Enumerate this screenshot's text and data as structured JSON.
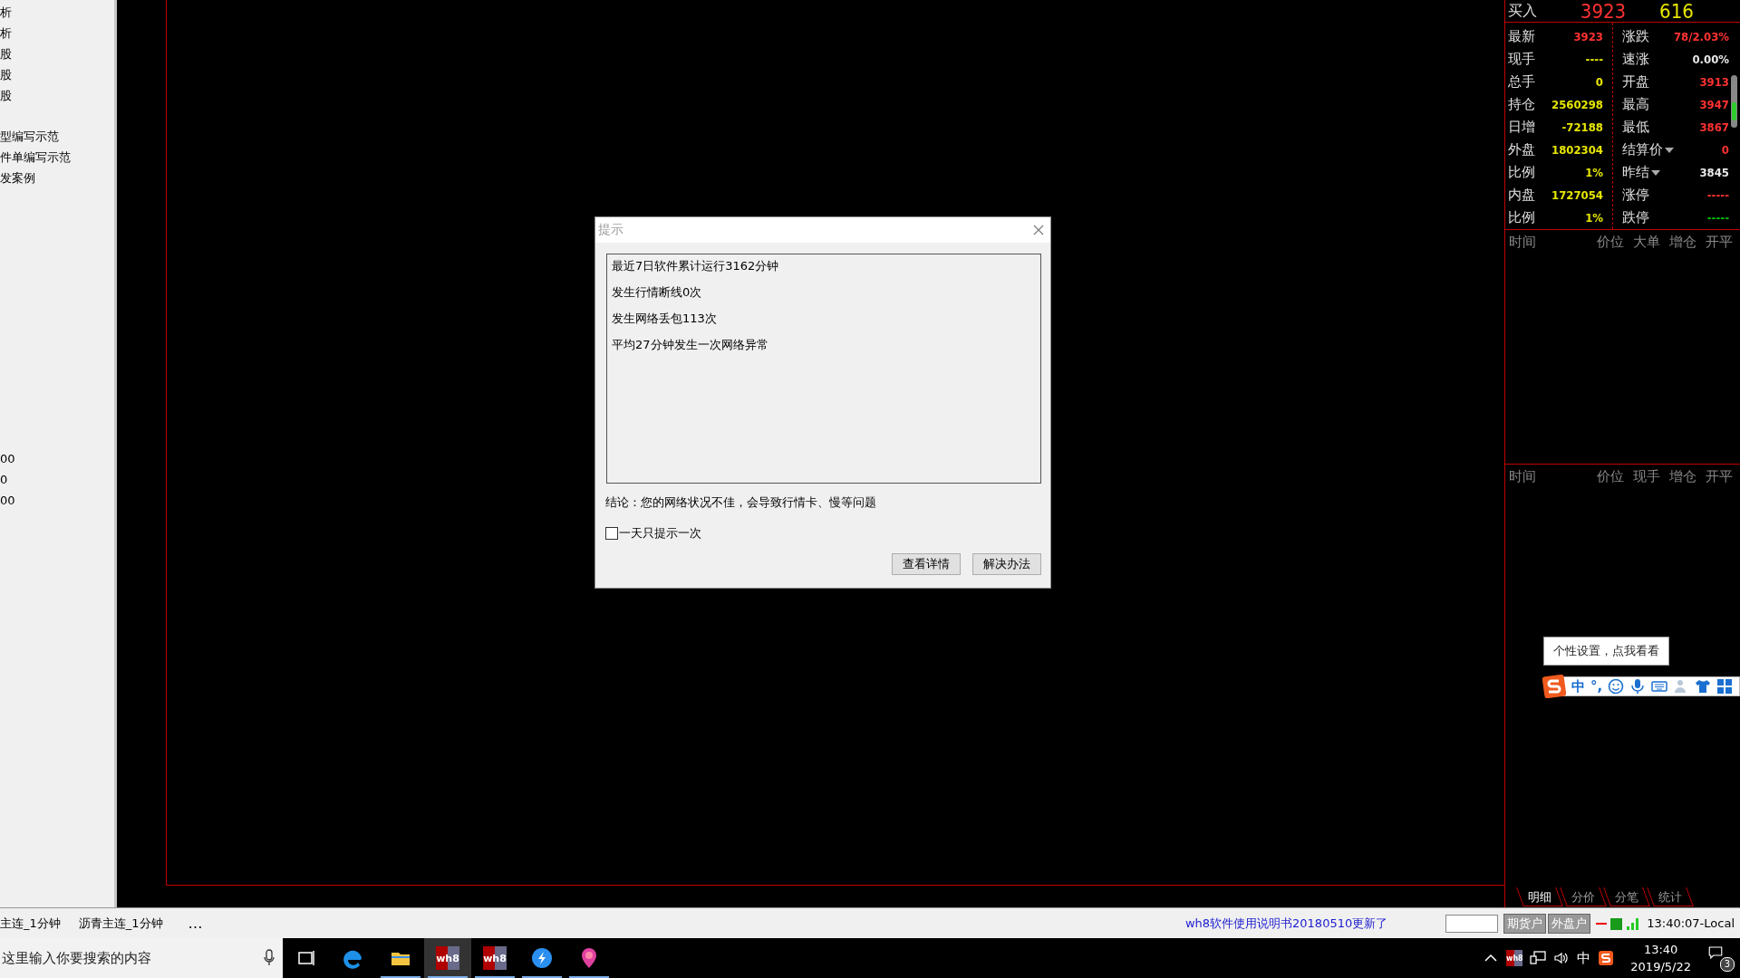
{
  "sidebar": {
    "groups": [
      [
        "析",
        "析",
        "股",
        "股",
        "股"
      ],
      [
        "型编写示范",
        "件单编写示范",
        "发案例"
      ],
      [
        "00",
        "0",
        "00"
      ]
    ]
  },
  "quote": {
    "buy_label": "买入",
    "buy_price": "3923",
    "buy_volume": "616",
    "left_rows": [
      {
        "label": "最新",
        "value": "3923",
        "color": "#ff3232"
      },
      {
        "label": "现手",
        "value": "----",
        "color": "#e6e600"
      },
      {
        "label": "总手",
        "value": "0",
        "color": "#e6e600"
      },
      {
        "label": "持仓",
        "value": "2560298",
        "color": "#e6e600"
      },
      {
        "label": "日增",
        "value": "-72188",
        "color": "#e6e600"
      },
      {
        "label": "外盘",
        "value": "1802304",
        "color": "#e6e600"
      },
      {
        "label": "比例",
        "value": "1%",
        "color": "#e6e600"
      },
      {
        "label": "内盘",
        "value": "1727054",
        "color": "#e6e600"
      },
      {
        "label": "比例",
        "value": "1%",
        "color": "#e6e600"
      }
    ],
    "right_rows": [
      {
        "label": "涨跌",
        "value": "78/2.03%",
        "color": "#ff3232",
        "dropdown": false
      },
      {
        "label": "速涨",
        "value": "0.00%",
        "color": "#e8e8e8",
        "dropdown": false
      },
      {
        "label": "开盘",
        "value": "3913",
        "color": "#ff3232",
        "dropdown": false
      },
      {
        "label": "最高",
        "value": "3947",
        "color": "#ff3232",
        "dropdown": false
      },
      {
        "label": "最低",
        "value": "3867",
        "color": "#ff3232",
        "dropdown": false
      },
      {
        "label": "结算价",
        "value": "0",
        "color": "#ff3232",
        "dropdown": true
      },
      {
        "label": "昨结",
        "value": "3845",
        "color": "#e8e8e8",
        "dropdown": true
      },
      {
        "label": "涨停",
        "value": "-----",
        "color": "#ff3232",
        "dropdown": false
      },
      {
        "label": "跌停",
        "value": "-----",
        "color": "#00c000",
        "dropdown": false
      }
    ],
    "big_order_columns": [
      "时间",
      "价位",
      "大单",
      "增仓",
      "开平"
    ],
    "tick_columns": [
      "时间",
      "价位",
      "现手",
      "增仓",
      "开平"
    ],
    "tabs": [
      {
        "label": "明细",
        "selected": true
      },
      {
        "label": "分价",
        "selected": false
      },
      {
        "label": "分笔",
        "selected": false
      },
      {
        "label": "统计",
        "selected": false
      }
    ]
  },
  "dialog": {
    "title": "提示",
    "lines": [
      "最近7日软件累计运行3162分钟",
      "发生行情断线0次",
      "发生网络丢包113次",
      "平均27分钟发生一次网络异常"
    ],
    "conclusion": "结论：您的网络状况不佳，会导致行情卡、慢等问题",
    "checkbox": {
      "label": "一天只提示一次",
      "checked": false
    },
    "buttons": [
      "查看详情",
      "解决办法"
    ]
  },
  "ime": {
    "tooltip": "个性设置，点我看看",
    "mode": "中",
    "punct": "°,"
  },
  "status_bar": {
    "periods": [
      "主连_1分钟",
      "沥青主连_1分钟"
    ],
    "more": "…",
    "notice": "wh8软件使用说明书20180510更新了",
    "buttons": [
      "期货户",
      "外盘户"
    ],
    "time": "13:40:07-Local"
  },
  "taskbar": {
    "search_placeholder": "这里输入你要搜索的内容",
    "apps": [
      {
        "kind": "taskview",
        "running": false,
        "selected": false
      },
      {
        "kind": "edge",
        "running": false,
        "selected": false
      },
      {
        "kind": "folder",
        "running": true,
        "selected": false
      },
      {
        "kind": "wh8",
        "label": "wh8",
        "running": true,
        "selected": true
      },
      {
        "kind": "wh8",
        "label": "wh8",
        "running": true,
        "selected": false
      },
      {
        "kind": "circle",
        "running": true,
        "selected": false
      },
      {
        "kind": "pin",
        "running": true,
        "selected": false
      }
    ],
    "tray": [
      {
        "kind": "chevron"
      },
      {
        "kind": "wh8",
        "label": "wh8"
      },
      {
        "kind": "network"
      },
      {
        "kind": "volume"
      },
      {
        "kind": "text",
        "label": "中"
      },
      {
        "kind": "sogou"
      }
    ],
    "time": "13:40",
    "date": "2019/5/22",
    "notifications": "3"
  }
}
